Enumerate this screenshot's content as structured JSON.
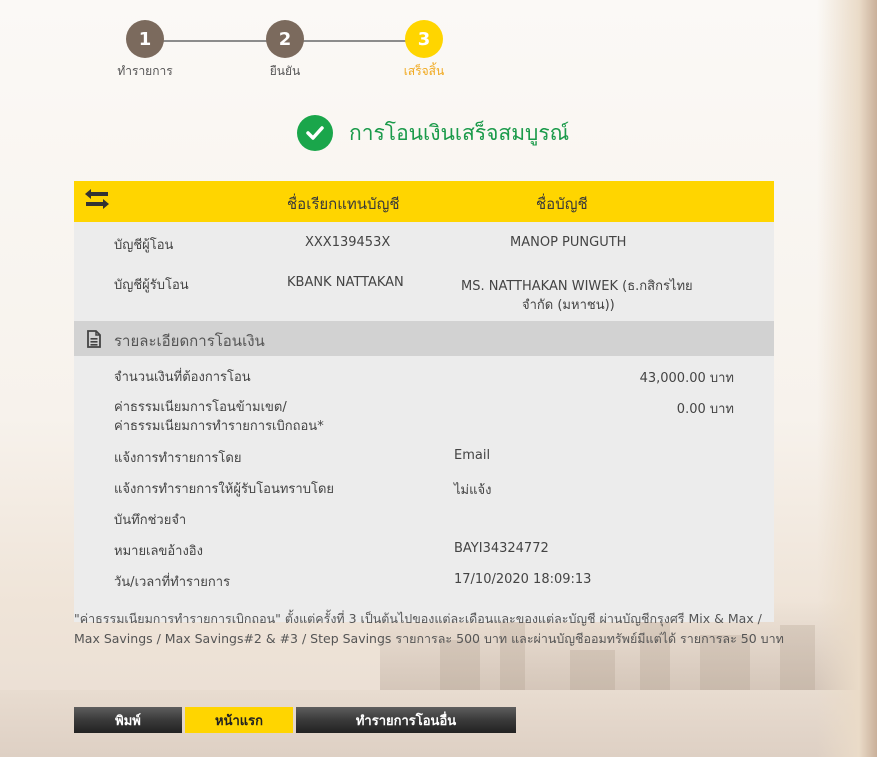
{
  "stepper": {
    "steps": [
      {
        "number": "1",
        "label": "ทำรายการ"
      },
      {
        "number": "2",
        "label": "ยืนยัน"
      },
      {
        "number": "3",
        "label": "เสร็จสิ้น"
      }
    ]
  },
  "success": {
    "title": "การโอนเงินเสร็จสมบูรณ์"
  },
  "accounts": {
    "col_alias": "ชื่อเรียกแทนบัญชี",
    "col_name": "ชื่อบัญชี",
    "from_label": "บัญชีผู้โอน",
    "from_alias": "XXX139453X",
    "from_name": "MANOP PUNGUTH",
    "to_label": "บัญชีผู้รับโอน",
    "to_alias": "KBANK NATTAKAN",
    "to_name_line1": "MS. NATTHAKAN WIWEK (ธ.กสิกรไทย",
    "to_name_line2": "จำกัด (มหาชน))"
  },
  "details": {
    "section_title": "รายละเอียดการโอนเงิน",
    "amount_label": "จำนวนเงินที่ต้องการโอน",
    "amount_value": "43,000.00 บาท",
    "fee_label_line1": "ค่าธรรมเนียมการโอนข้ามเขต/",
    "fee_label_line2": "ค่าธรรมเนียมการทำรายการเบิกถอน*",
    "fee_value": "0.00 บาท",
    "notify_label": "แจ้งการทำรายการโดย",
    "notify_value": "Email",
    "notify_recipient_label": "แจ้งการทำรายการให้ผู้รับโอนทราบโดย",
    "notify_recipient_value": "ไม่แจ้ง",
    "memo_label": "บันทึกช่วยจำ",
    "memo_value": "",
    "reference_label": "หมายเลขอ้างอิง",
    "reference_value": "BAYI34324772",
    "datetime_label": "วัน/เวลาที่ทำรายการ",
    "datetime_value": "17/10/2020 18:09:13"
  },
  "note": {
    "line1": "\"ค่าธรรมเนียมการทำรายการเบิกถอน\" ตั้งแต่ครั้งที่ 3 เป็นต้นไปของแต่ละเดือนและของแต่ละบัญชี ผ่านบัญชีกรุงศรี Mix & Max /",
    "line2": "Max Savings / Max Savings#2 & #3 / Step Savings รายการละ 500 บาท และผ่านบัญชีออมทรัพย์มีแต่ได้ รายการละ 50 บาท"
  },
  "buttons": {
    "print": "พิมพ์",
    "home": "หน้าแรก",
    "other": "ทำรายการโอนอื่น"
  },
  "colors": {
    "accent": "#ffd500",
    "success": "#1aa64b",
    "step_inactive": "#7b6a5d"
  },
  "icons": {
    "swap": "swap-arrows-icon",
    "document": "document-icon",
    "check": "check-circle-icon"
  }
}
